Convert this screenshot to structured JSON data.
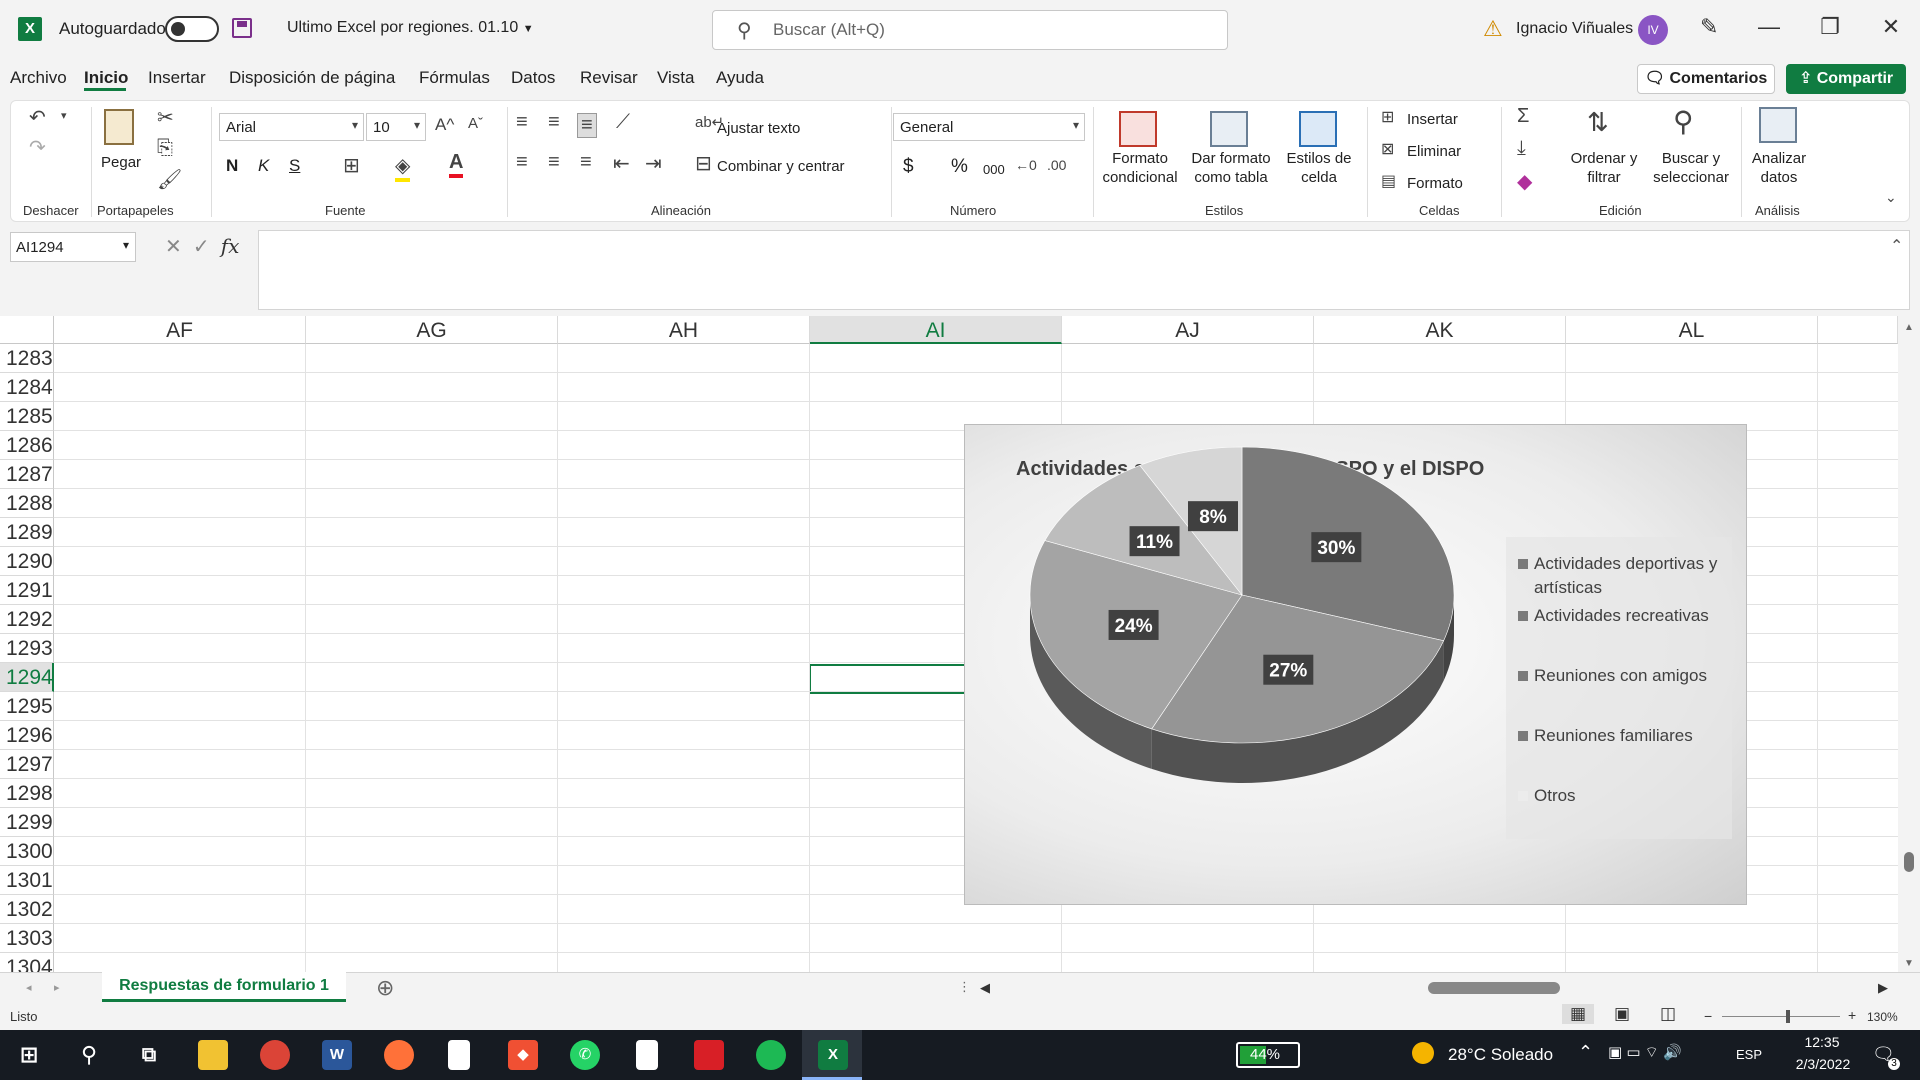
{
  "titlebar": {
    "app_icon": "X",
    "autosave_label": "Autoguardado",
    "filename": "Ultimo Excel por regiones. 01.10",
    "search_placeholder": "Buscar (Alt+Q)",
    "username": "Ignacio Viñuales",
    "avatar_initials": "IV"
  },
  "menu": {
    "tabs": [
      "Archivo",
      "Inicio",
      "Insertar",
      "Disposición de página",
      "Fórmulas",
      "Datos",
      "Revisar",
      "Vista",
      "Ayuda"
    ],
    "active_tab": "Inicio",
    "comments_label": "Comentarios",
    "share_label": "Compartir"
  },
  "ribbon": {
    "groups": {
      "deshacer": "Deshacer",
      "portapapeles": "Portapapeles",
      "fuente": "Fuente",
      "alineacion": "Alineación",
      "numero": "Número",
      "estilos": "Estilos",
      "celdas": "Celdas",
      "edicion": "Edición",
      "analisis": "Análisis"
    },
    "paste_label": "Pegar",
    "font_name": "Arial",
    "font_size": "10",
    "bold": "N",
    "italic": "K",
    "underline": "S",
    "wrap_text": "Ajustar texto",
    "merge_center": "Combinar y centrar",
    "number_format": "General",
    "currency": "$",
    "percent": "%",
    "thousands": "000",
    "cond_format_1": "Formato",
    "cond_format_2": "condicional",
    "table_format_1": "Dar formato",
    "table_format_2": "como tabla",
    "cell_styles_1": "Estilos de",
    "cell_styles_2": "celda",
    "insert": "Insertar",
    "delete": "Eliminar",
    "format": "Formato",
    "sort_1": "Ordenar y",
    "sort_2": "filtrar",
    "find_1": "Buscar y",
    "find_2": "seleccionar",
    "analyze_1": "Analizar",
    "analyze_2": "datos"
  },
  "formula_bar": {
    "name_box": "AI1294",
    "fx": "fx",
    "content": ""
  },
  "grid": {
    "columns": [
      "AF",
      "AG",
      "AH",
      "AI",
      "AJ",
      "AK",
      "AL"
    ],
    "selected_column": "AI",
    "rows": [
      "1283",
      "1284",
      "1285",
      "1286",
      "1287",
      "1288",
      "1289",
      "1290",
      "1291",
      "1292",
      "1293",
      "1294",
      "1295",
      "1296",
      "1297",
      "1298",
      "1299",
      "1300",
      "1301",
      "1302",
      "1303",
      "1304"
    ],
    "selected_row": "1294"
  },
  "chart_data": {
    "type": "pie",
    "title": "Actividades suspendidas por el ASPO y el DISPO",
    "categories": [
      "Actividades deportivas y artísticas",
      "Actividades recreativas",
      "Reuniones con amigos",
      "Reuniones familiares",
      "Otros"
    ],
    "values": [
      30,
      27,
      24,
      11,
      8
    ],
    "data_labels": [
      "30%",
      "27%",
      "24%",
      "11%",
      "8%"
    ],
    "colors": [
      "#7a7a7a",
      "#959595",
      "#a4a4a4",
      "#bdbdbd",
      "#d6d6d6"
    ],
    "legend_position": "right",
    "style": "3d"
  },
  "sheets": {
    "active": "Respuestas de formulario 1"
  },
  "status": {
    "ready": "Listo",
    "zoom": "130%"
  },
  "taskbar": {
    "battery": "44%",
    "weather": "28°C Soleado",
    "language": "ESP",
    "time": "12:35",
    "date": "2/3/2022",
    "notifications": "3"
  }
}
